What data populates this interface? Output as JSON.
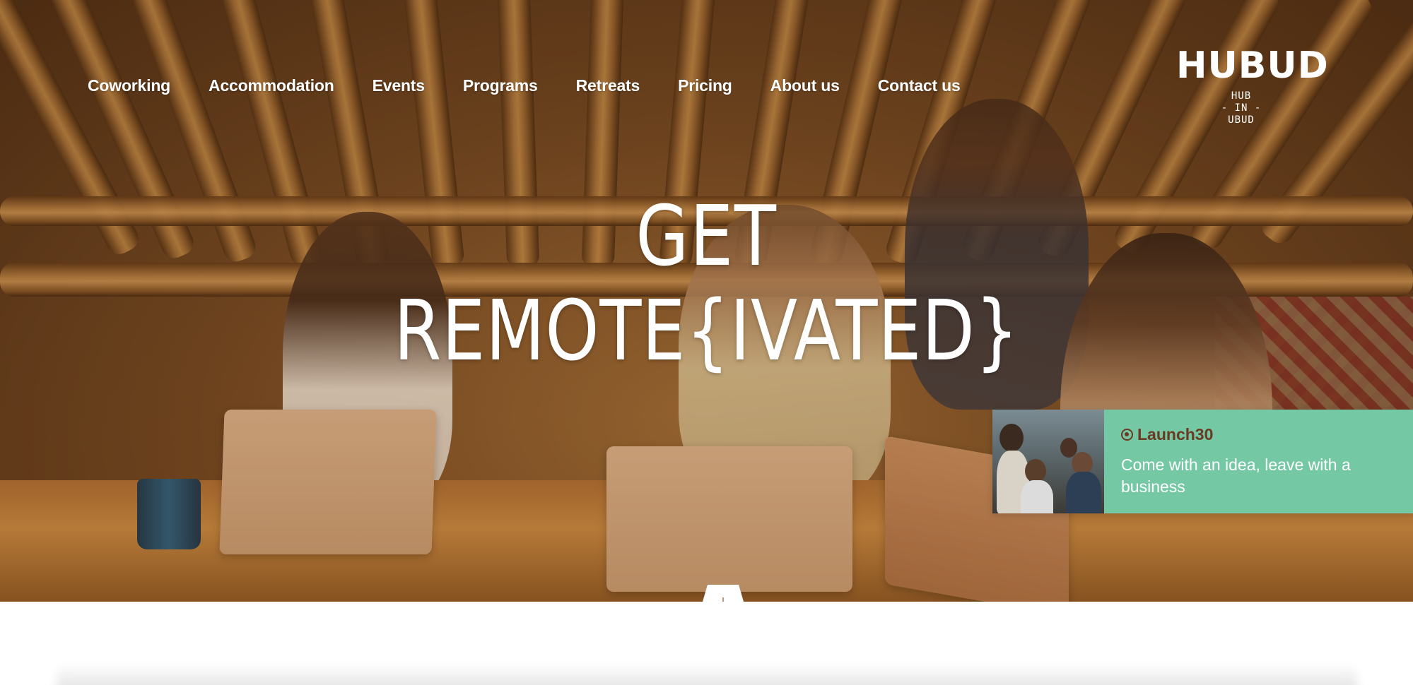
{
  "nav": {
    "items": [
      {
        "label": "Coworking"
      },
      {
        "label": "Accommodation"
      },
      {
        "label": "Events"
      },
      {
        "label": "Programs"
      },
      {
        "label": "Retreats"
      },
      {
        "label": "Pricing"
      },
      {
        "label": "About us"
      },
      {
        "label": "Contact us"
      }
    ]
  },
  "logo": {
    "name": "HUBUD",
    "sub_line1": "HUB",
    "sub_line2": "- IN -",
    "sub_line3": "UBUD"
  },
  "hero": {
    "headline_line1": "GET",
    "headline_line2": "REMOTE{IVATED}"
  },
  "promo": {
    "tag": "Launch30",
    "text": "Come with an idea, leave with a business",
    "accent_color": "#74c9a4",
    "tag_color": "#6b3a22"
  },
  "scroll": {
    "icon": "arrow-down-icon"
  }
}
